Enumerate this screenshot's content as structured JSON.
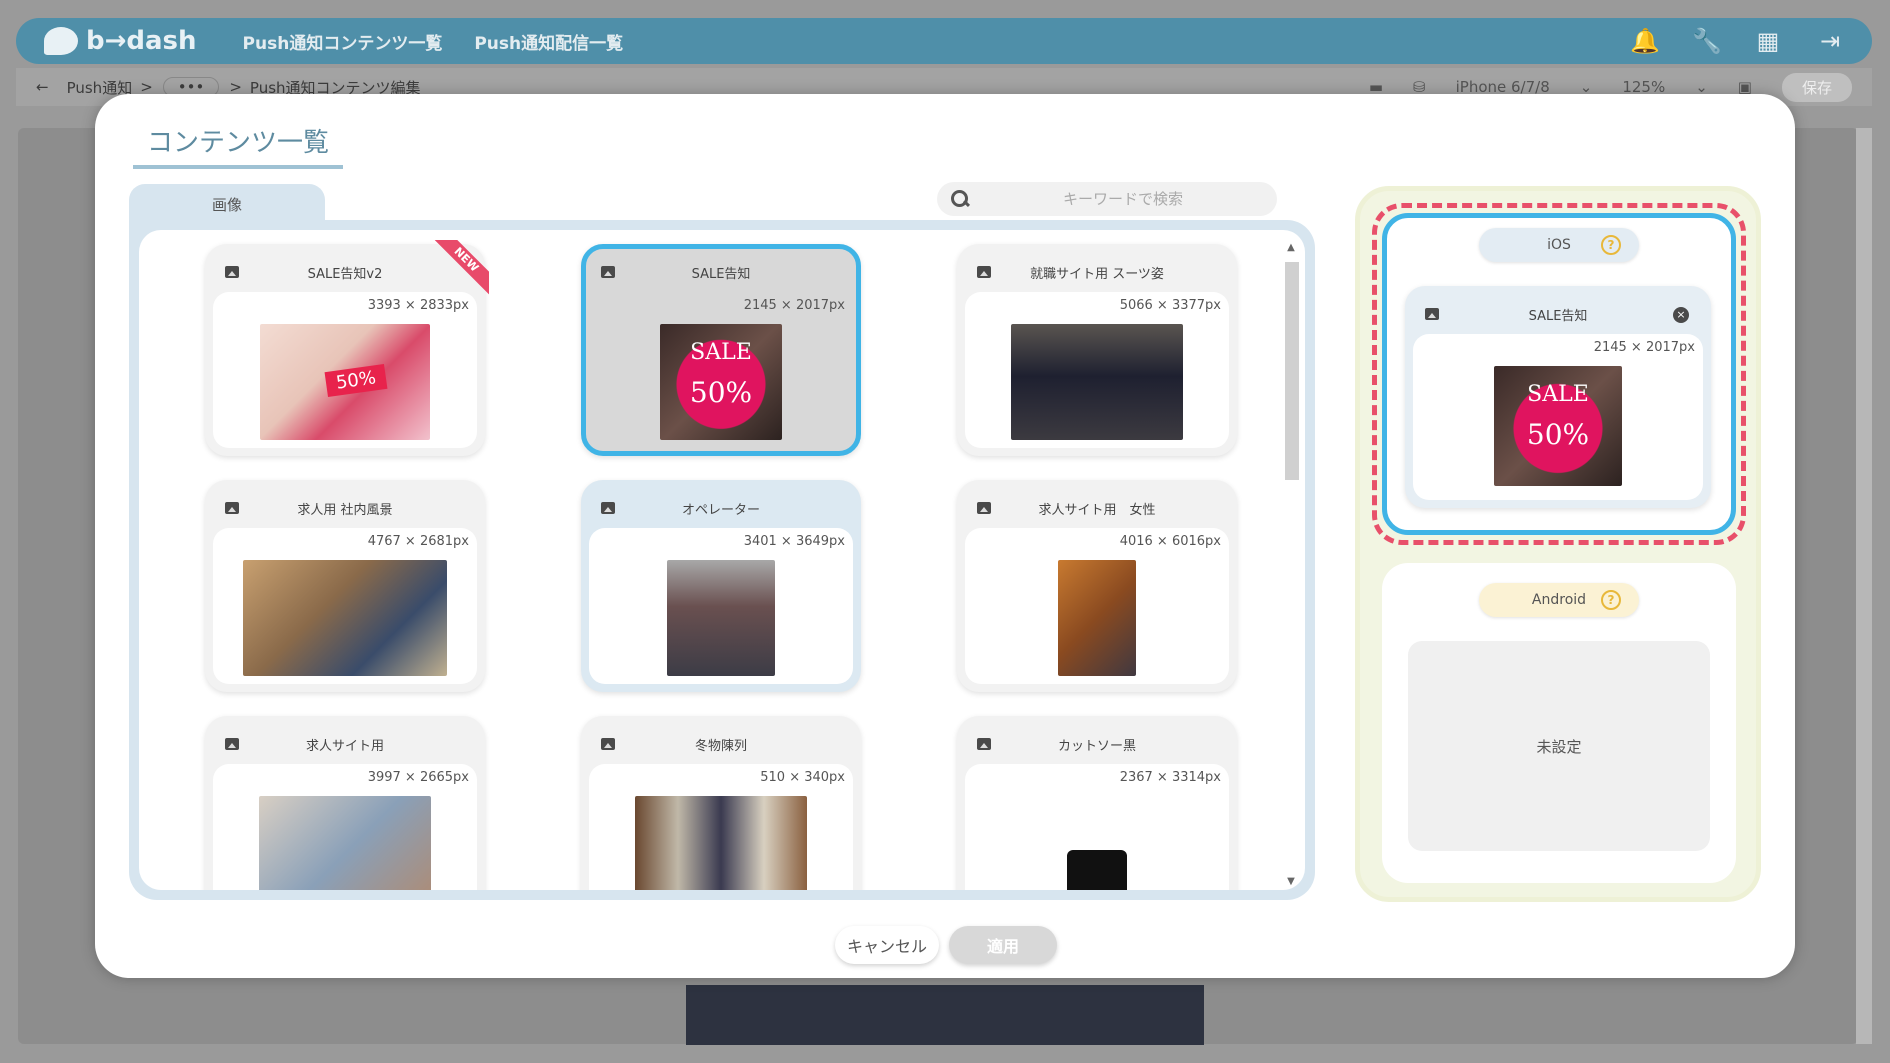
{
  "app": {
    "logo_text": "b→dash",
    "nav": [
      "Push通知コンテンツ一覧",
      "Push通知配信一覧"
    ],
    "icons": [
      "bell-icon",
      "wrench-icon",
      "grid-icon",
      "logout-icon"
    ]
  },
  "subbar": {
    "crumb": "Push通知",
    "separator": ">",
    "dots": "•••",
    "page": "Push通知コンテンツ編集",
    "device": "iPhone 6/7/8",
    "zoom": "125%",
    "save_label": "保存"
  },
  "modal": {
    "title": "コンテンツ一覧",
    "tab_label": "画像",
    "search_placeholder": "キーワードで検索",
    "cards": [
      {
        "name": "SALE告知v2",
        "size": "3393 × 2833px",
        "badge": "NEW",
        "thumb": "hand"
      },
      {
        "name": "SALE告知",
        "size": "2145 × 2017px",
        "thumb": "sale",
        "state": "selected"
      },
      {
        "name": "就職サイト用 スーツ姿",
        "size": "5066 × 3377px",
        "thumb": "suit"
      },
      {
        "name": "求人用 社内風景",
        "size": "4767 × 2681px",
        "thumb": "office"
      },
      {
        "name": "オペレーター",
        "size": "3401 × 3649px",
        "thumb": "woman",
        "state": "light"
      },
      {
        "name": "求人サイト用　女性",
        "size": "4016 × 6016px",
        "thumb": "woman2"
      },
      {
        "name": "求人サイト用",
        "size": "3997 × 2665px",
        "thumb": "group"
      },
      {
        "name": "冬物陳列",
        "size": "510 × 340px",
        "thumb": "rack"
      },
      {
        "name": "カットソー黒",
        "size": "2367 × 3314px",
        "thumb": "shirt"
      }
    ],
    "sale_thumb_text": {
      "line1": "SALE",
      "line2": "50%"
    },
    "hand_tag_text": "50%",
    "preview": {
      "ios_label": "iOS",
      "help": "?",
      "ios_card": {
        "name": "SALE告知",
        "size": "2145 × 2017px",
        "close": "×"
      },
      "android_label": "Android",
      "android_empty": "未設定"
    },
    "cancel_label": "キャンセル",
    "apply_label": "適用"
  },
  "colors": {
    "accent_blue": "#40b4e6",
    "highlight_dash": "#e8506a",
    "topbar": "#4f8fa9",
    "badge_new": "#e84a6a"
  }
}
